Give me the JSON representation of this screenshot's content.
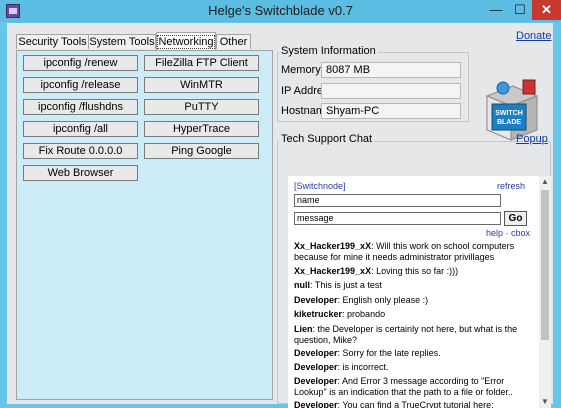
{
  "window": {
    "title": "Helge's Switchblade v0.7",
    "minimize": "—",
    "maximize": "☐",
    "close": "✕"
  },
  "tabs": [
    {
      "label": "Security Tools"
    },
    {
      "label": "System Tools"
    },
    {
      "label": "Networking",
      "active": true
    },
    {
      "label": "Other"
    }
  ],
  "buttons": {
    "ipconfig_renew": "ipconfig /renew",
    "ipconfig_release": "ipconfig /release",
    "ipconfig_flushdns": "ipconfig /flushdns",
    "ipconfig_all": "ipconfig /all",
    "fix_route": "Fix Route 0.0.0.0",
    "web_browser": "Web Browser",
    "filezilla": "FileZilla FTP Client",
    "winmtr": "WinMTR",
    "putty": "PuTTY",
    "hypertrace": "HyperTrace",
    "ping_google": "Ping Google"
  },
  "links": {
    "donate": "Donate",
    "popup": "Popup"
  },
  "system_info": {
    "title": "System Information",
    "memory_label": "Memory",
    "memory_value": "8087 MB",
    "ip_label": "IP Address",
    "ip_value": "",
    "hostname_label": "Hostname",
    "hostname_value": "Shyam-PC"
  },
  "logo": {
    "text": "SWITCH BLADE"
  },
  "chat": {
    "title": "Tech Support Chat",
    "header": "[Switchnode]",
    "refresh": "refresh",
    "name_value": "name",
    "message_value": "message",
    "go": "Go",
    "help": "help · cbox",
    "messages": [
      {
        "user": "Xx_Hacker199_xX",
        "text": ": Will this work on school computers because for mine it needs administrator privillages"
      },
      {
        "user": "Xx_Hacker199_xX",
        "text": ": Loving this so far :)))"
      },
      {
        "user": "null",
        "text": ": This is just a test"
      },
      {
        "user": "Developer",
        "text": ": English only please :)"
      },
      {
        "user": "kiketrucker",
        "text": ": probando"
      },
      {
        "user": "Lien",
        "text": ": the Developer is certainly not here, but what is the question, Mike?"
      },
      {
        "user": "Developer",
        "text": ": Sorry for the late replies."
      },
      {
        "user": "Developer",
        "text": ": is incorrect."
      },
      {
        "user": "Developer",
        "text": ": And Error 3 message according to \"Error Lookup\" is an indication that the path to a file or folder.."
      },
      {
        "user": "Developer",
        "text": ": You can find a TrueCrypt tutorial here:"
      }
    ]
  },
  "colors": {
    "window_frame": "#66c6e8",
    "panel_bg": "#ccecf7",
    "close_button": "#c7392f",
    "link": "#0b3ca8"
  }
}
